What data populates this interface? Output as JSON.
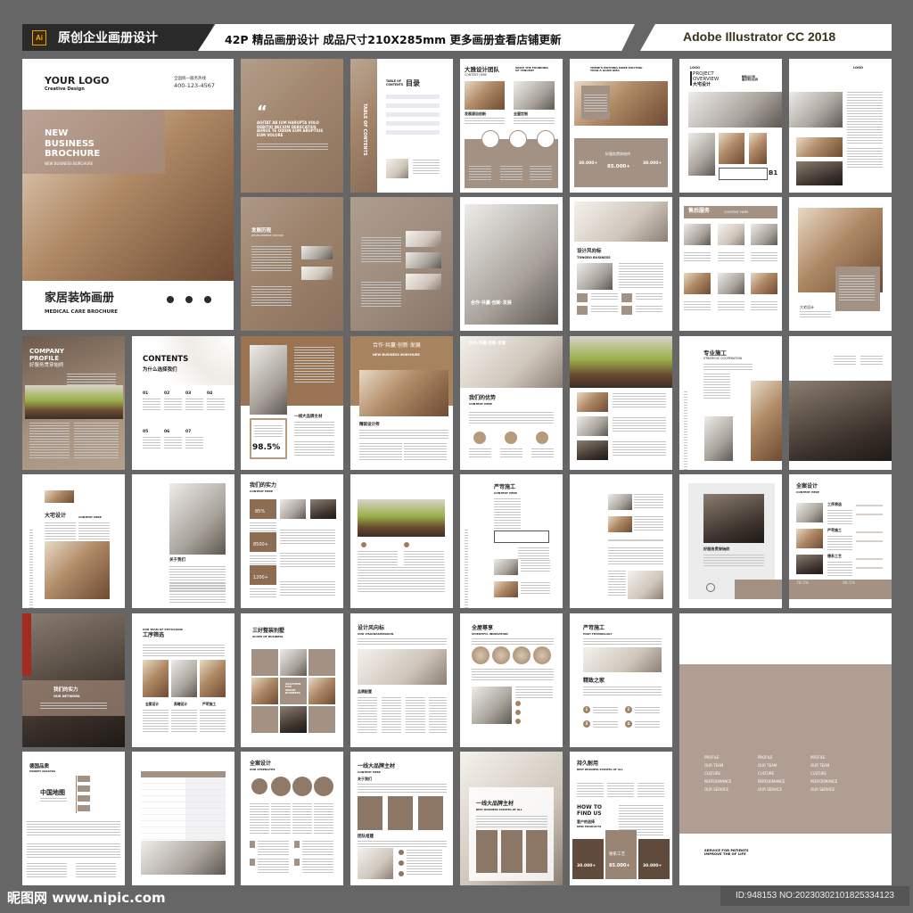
{
  "header": {
    "badge": "Ai",
    "left_title": "原创企业画册设计",
    "center_text": "42P 精品画册设计 成品尺寸210X285mm 更多画册查看店铺更新",
    "right_text": "Adobe Illustrator CC 2018"
  },
  "footer": {
    "logo": "昵图网 www.nipic.com",
    "id": "ID:948153 NO:20230302101825334123"
  },
  "colors": {
    "background": "#666666",
    "brand_brown": "#a39283",
    "dark_brown": "#7b6657",
    "ochre": "#9a7452",
    "back_cover": "#b19e93"
  },
  "pages": {
    "cover": {
      "logo": "YOUR LOGO",
      "logo_sub": "Creative Design",
      "hotline": "全国统一服务热线",
      "phone": "400-123-4567",
      "headline": "NEW\nBUSINESS\nBROCHURE",
      "headline_sub": "NEW BUSINESS BORCHURE",
      "title_cn": "家居装饰画册",
      "title_en": "MEDICAL CARE BROCHURE"
    },
    "quote": {
      "mark": "“",
      "text": "AOITAT AB IUM HARUPTA VOLO DEBITIO NECIUM DERSCATIUS AURUS TE ODION EUM ARUPTIUS EUM VOLORE"
    },
    "toc": {
      "vertical": "TABLE OF CONTENTS",
      "label": "TABLE OF\nCONTENTS",
      "cn": "目录"
    },
    "team": {
      "title": "大雅设计团队",
      "sub": "CONTENT HERE",
      "tagline": "SINCE THE FOUNDING\nOF TENCENT",
      "cap1": "发展源自创新",
      "cap2": "全屋定制"
    },
    "exciting": {
      "text": "THERE'S NOTHING MORE EXCITING\nTHAN A GOOD IDEA",
      "center": "好服务贯穿始终",
      "stat1": "30.000+",
      "stat2": "85.000+",
      "stat3": "30.000+"
    },
    "project": {
      "logo": "LOGO",
      "title": "PROJECT\nOVERVIEW",
      "cn": "大宅设计",
      "sub": "精致设计师\n重点项目名称",
      "floor": "B1"
    },
    "project2": {
      "logo": "LOGO"
    },
    "history": {
      "title": "发展历程",
      "sub": "DEVELOPMENT HISTORY"
    },
    "bedroom": {
      "text": "合作·共赢·创新·发展"
    },
    "tongro": {
      "title": "设计风向标",
      "sub": "TONGRO BUSINESS"
    },
    "aftersale": {
      "title": "售后服务",
      "sub": "CONTENT HERE"
    },
    "photo_box": {
      "caption": "大宅设计"
    },
    "profile": {
      "title": "COMPANY\nPROFILE",
      "cn": "好服务贯穿始终"
    },
    "contents": {
      "title": "CONTENTS",
      "cn": "为什么选择我们",
      "nums": [
        "01",
        "02",
        "03",
        "04",
        "05",
        "06",
        "07"
      ]
    },
    "p985": {
      "stat": "98.5%",
      "title": "一线大品牌主材"
    },
    "coop": {
      "title": "合作·共赢·创新·发展",
      "sub": "NEW BUSINESS BORCHURE",
      "caption": "精装设计师"
    },
    "advantage": {
      "overlay": "合作·共赢·创新·发展",
      "title": "我们的优势",
      "sub": "CONTENT HERE"
    },
    "construction": {
      "title": "专业施工",
      "sub": "STRATEGIC COOPERATION"
    },
    "dazhai": {
      "title": "大宅设计",
      "sub": "CONTENT HERE"
    },
    "about": {
      "title": "关于我们"
    },
    "strength": {
      "title": "我们的实力",
      "sub": "CONTENT HERE",
      "s1": "85%",
      "s2": "8500+",
      "s3": "1200+"
    },
    "yanke": {
      "title": "严苛施工",
      "sub": "CONTENT HERE"
    },
    "service": {
      "title": "好服务贯穿始终"
    },
    "quanan": {
      "title": "全案设计",
      "sub": "CONTENT HERE",
      "i1": "工序筛选",
      "i2": "严苛施工",
      "i3": "德系工艺",
      "s1": "78.5%",
      "s2": "86.5%"
    },
    "network": {
      "title": "我们的实力",
      "sub": "OUR NETWORK"
    },
    "process": {
      "sub": "OUR TEAM OF PHYSICIANS",
      "title": "工序筛选",
      "c1": "全案设计",
      "c2": "高端设计",
      "c3": "严苛施工"
    },
    "sanhao": {
      "title": "三好整装别墅",
      "sub": "SCOPE OF BUSINESS",
      "center": "SOLUTION\nFOR\nSMART\nBUSINESS"
    },
    "fengxiang": {
      "title": "设计风向标",
      "sub": "OUR VISIONARIMISSION",
      "caption": "品牌配置"
    },
    "quanwu": {
      "title": "全屋尊享",
      "sub": "SCIENTIFIC INNOVATION"
    },
    "yanke2": {
      "title": "严苛施工",
      "sub": "HIGH TECHNOLOGY",
      "caption": "精致之家",
      "nums": [
        "1",
        "2",
        "3",
        "4"
      ]
    },
    "back": {
      "items": [
        "PROFILE",
        "OUR TEAM",
        "CULTURE",
        "PERFORMANCE",
        "OUR SERVICE"
      ],
      "tagline": "SERVICE FOR PATIENTS\nIMPROVE THE OF LIFE"
    },
    "german": {
      "title": "德国品质",
      "sub": "MARKET ANALYSIS",
      "map": "中国地图"
    },
    "quanan2": {
      "title": "全案设计",
      "sub": "OUR STRENGTHS"
    },
    "brand": {
      "title": "一线大品牌主材",
      "sub": "CONTENT HERE",
      "about": "关于我们",
      "team": "团队组建"
    },
    "brandphoto": {
      "title": "一线大品牌主材",
      "sub": "BEST BUSINESS STRATEG OF ALL"
    },
    "durable": {
      "title": "持久耐用",
      "sub": "BEST BUSINESS STRATEG OF ALL",
      "find": "HOW TO\nFIND US",
      "cn": "客户的选择",
      "en": "NEW PRODUCTS",
      "s1": "30.000+",
      "s2": "85.000+",
      "s3": "30.000+",
      "label": "德系工艺"
    }
  }
}
